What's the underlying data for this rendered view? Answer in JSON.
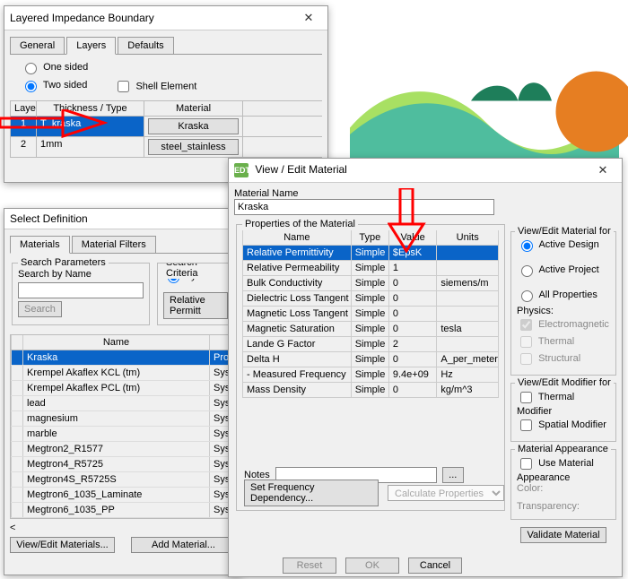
{
  "layered": {
    "title": "Layered Impedance Boundary",
    "tabs": [
      "General",
      "Layers",
      "Defaults"
    ],
    "active_tab": 1,
    "one_sided_label": "One sided",
    "two_sided_label": "Two sided",
    "two_sided_checked": true,
    "shell_element_label": "Shell Element",
    "shell_element_checked": false,
    "headers": {
      "layer": "Layer",
      "thickness_type": "Thickness / Type",
      "material": "Material"
    },
    "rows": [
      {
        "layer": "1",
        "thickness": "T_kraska",
        "material": "Kraska",
        "selected": true
      },
      {
        "layer": "2",
        "thickness": "1mm",
        "material": "steel_stainless",
        "selected": false
      }
    ]
  },
  "seldef": {
    "title": "Select Definition",
    "tabs": [
      "Materials",
      "Material Filters"
    ],
    "active_tab": 0,
    "search_group": "Search Parameters",
    "search_by_name": "Search by Name",
    "search_value": "",
    "search_button": "Search",
    "criteria_group": "Search Criteria",
    "criteria_by_name": "by Name",
    "rel_perm_button": "Relative Permitt",
    "name_col": "Name",
    "origin_col": "",
    "rows": [
      {
        "name": "Kraska",
        "origin": "Pro",
        "selected": true
      },
      {
        "name": "Krempel Akaflex KCL (tm)",
        "origin": "Sys"
      },
      {
        "name": "Krempel Akaflex PCL (tm)",
        "origin": "Sys"
      },
      {
        "name": "lead",
        "origin": "Sys"
      },
      {
        "name": "magnesium",
        "origin": "Sys"
      },
      {
        "name": "marble",
        "origin": "Sys"
      },
      {
        "name": "Megtron2_R1577",
        "origin": "Sys"
      },
      {
        "name": "Megtron4_R5725",
        "origin": "Sys"
      },
      {
        "name": "Megtron4S_R5725S",
        "origin": "Sys"
      },
      {
        "name": "Megtron6_1035_Laminate",
        "origin": "Sys"
      },
      {
        "name": "Megtron6_1035_PP",
        "origin": "Sys"
      }
    ],
    "view_edit_btn": "View/Edit Materials...",
    "add_material_btn": "Add Material..."
  },
  "viewEdit": {
    "icon": "EDT",
    "title": "View / Edit Material",
    "mat_name_label": "Material Name",
    "mat_name_value": "Kraska",
    "props_group": "Properties of the Material",
    "headers": {
      "name": "Name",
      "type": "Type",
      "value": "Value",
      "units": "Units"
    },
    "rows": [
      {
        "name": "Relative Permittivity",
        "type": "Simple",
        "value": "$EpsK",
        "units": "",
        "selected": true
      },
      {
        "name": "Relative Permeability",
        "type": "Simple",
        "value": "1",
        "units": ""
      },
      {
        "name": "Bulk Conductivity",
        "type": "Simple",
        "value": "0",
        "units": "siemens/m"
      },
      {
        "name": "Dielectric Loss Tangent",
        "type": "Simple",
        "value": "0",
        "units": ""
      },
      {
        "name": "Magnetic Loss Tangent",
        "type": "Simple",
        "value": "0",
        "units": ""
      },
      {
        "name": "Magnetic Saturation",
        "type": "Simple",
        "value": "0",
        "units": "tesla"
      },
      {
        "name": "Lande G Factor",
        "type": "Simple",
        "value": "2",
        "units": ""
      },
      {
        "name": "Delta H",
        "type": "Simple",
        "value": "0",
        "units": "A_per_meter"
      },
      {
        "name": "  - Measured Frequency",
        "type": "Simple",
        "value": "9.4e+09",
        "units": "Hz"
      },
      {
        "name": "Mass Density",
        "type": "Simple",
        "value": "0",
        "units": "kg/m^3"
      }
    ],
    "view_for_group": "View/Edit Material for",
    "active_design": "Active Design",
    "active_project": "Active Project",
    "all_properties": "All Properties",
    "physics_label": "Physics:",
    "phys_em": "Electromagnetic",
    "phys_thermal": "Thermal",
    "phys_struct": "Structural",
    "modifier_group": "View/Edit Modifier for",
    "thermal_mod": "Thermal Modifier",
    "spatial_mod": "Spatial Modifier",
    "appearance_group": "Material Appearance",
    "use_appearance": "Use Material Appearance",
    "color_label": "Color:",
    "transparency_label": "Transparency:",
    "validate_btn": "Validate Material",
    "notes_label": "Notes",
    "notes_more": "...",
    "set_freq_btn": "Set Frequency Dependency...",
    "calc_props": "Calculate Properties for:",
    "reset_btn": "Reset",
    "ok_btn": "OK",
    "cancel_btn": "Cancel"
  }
}
